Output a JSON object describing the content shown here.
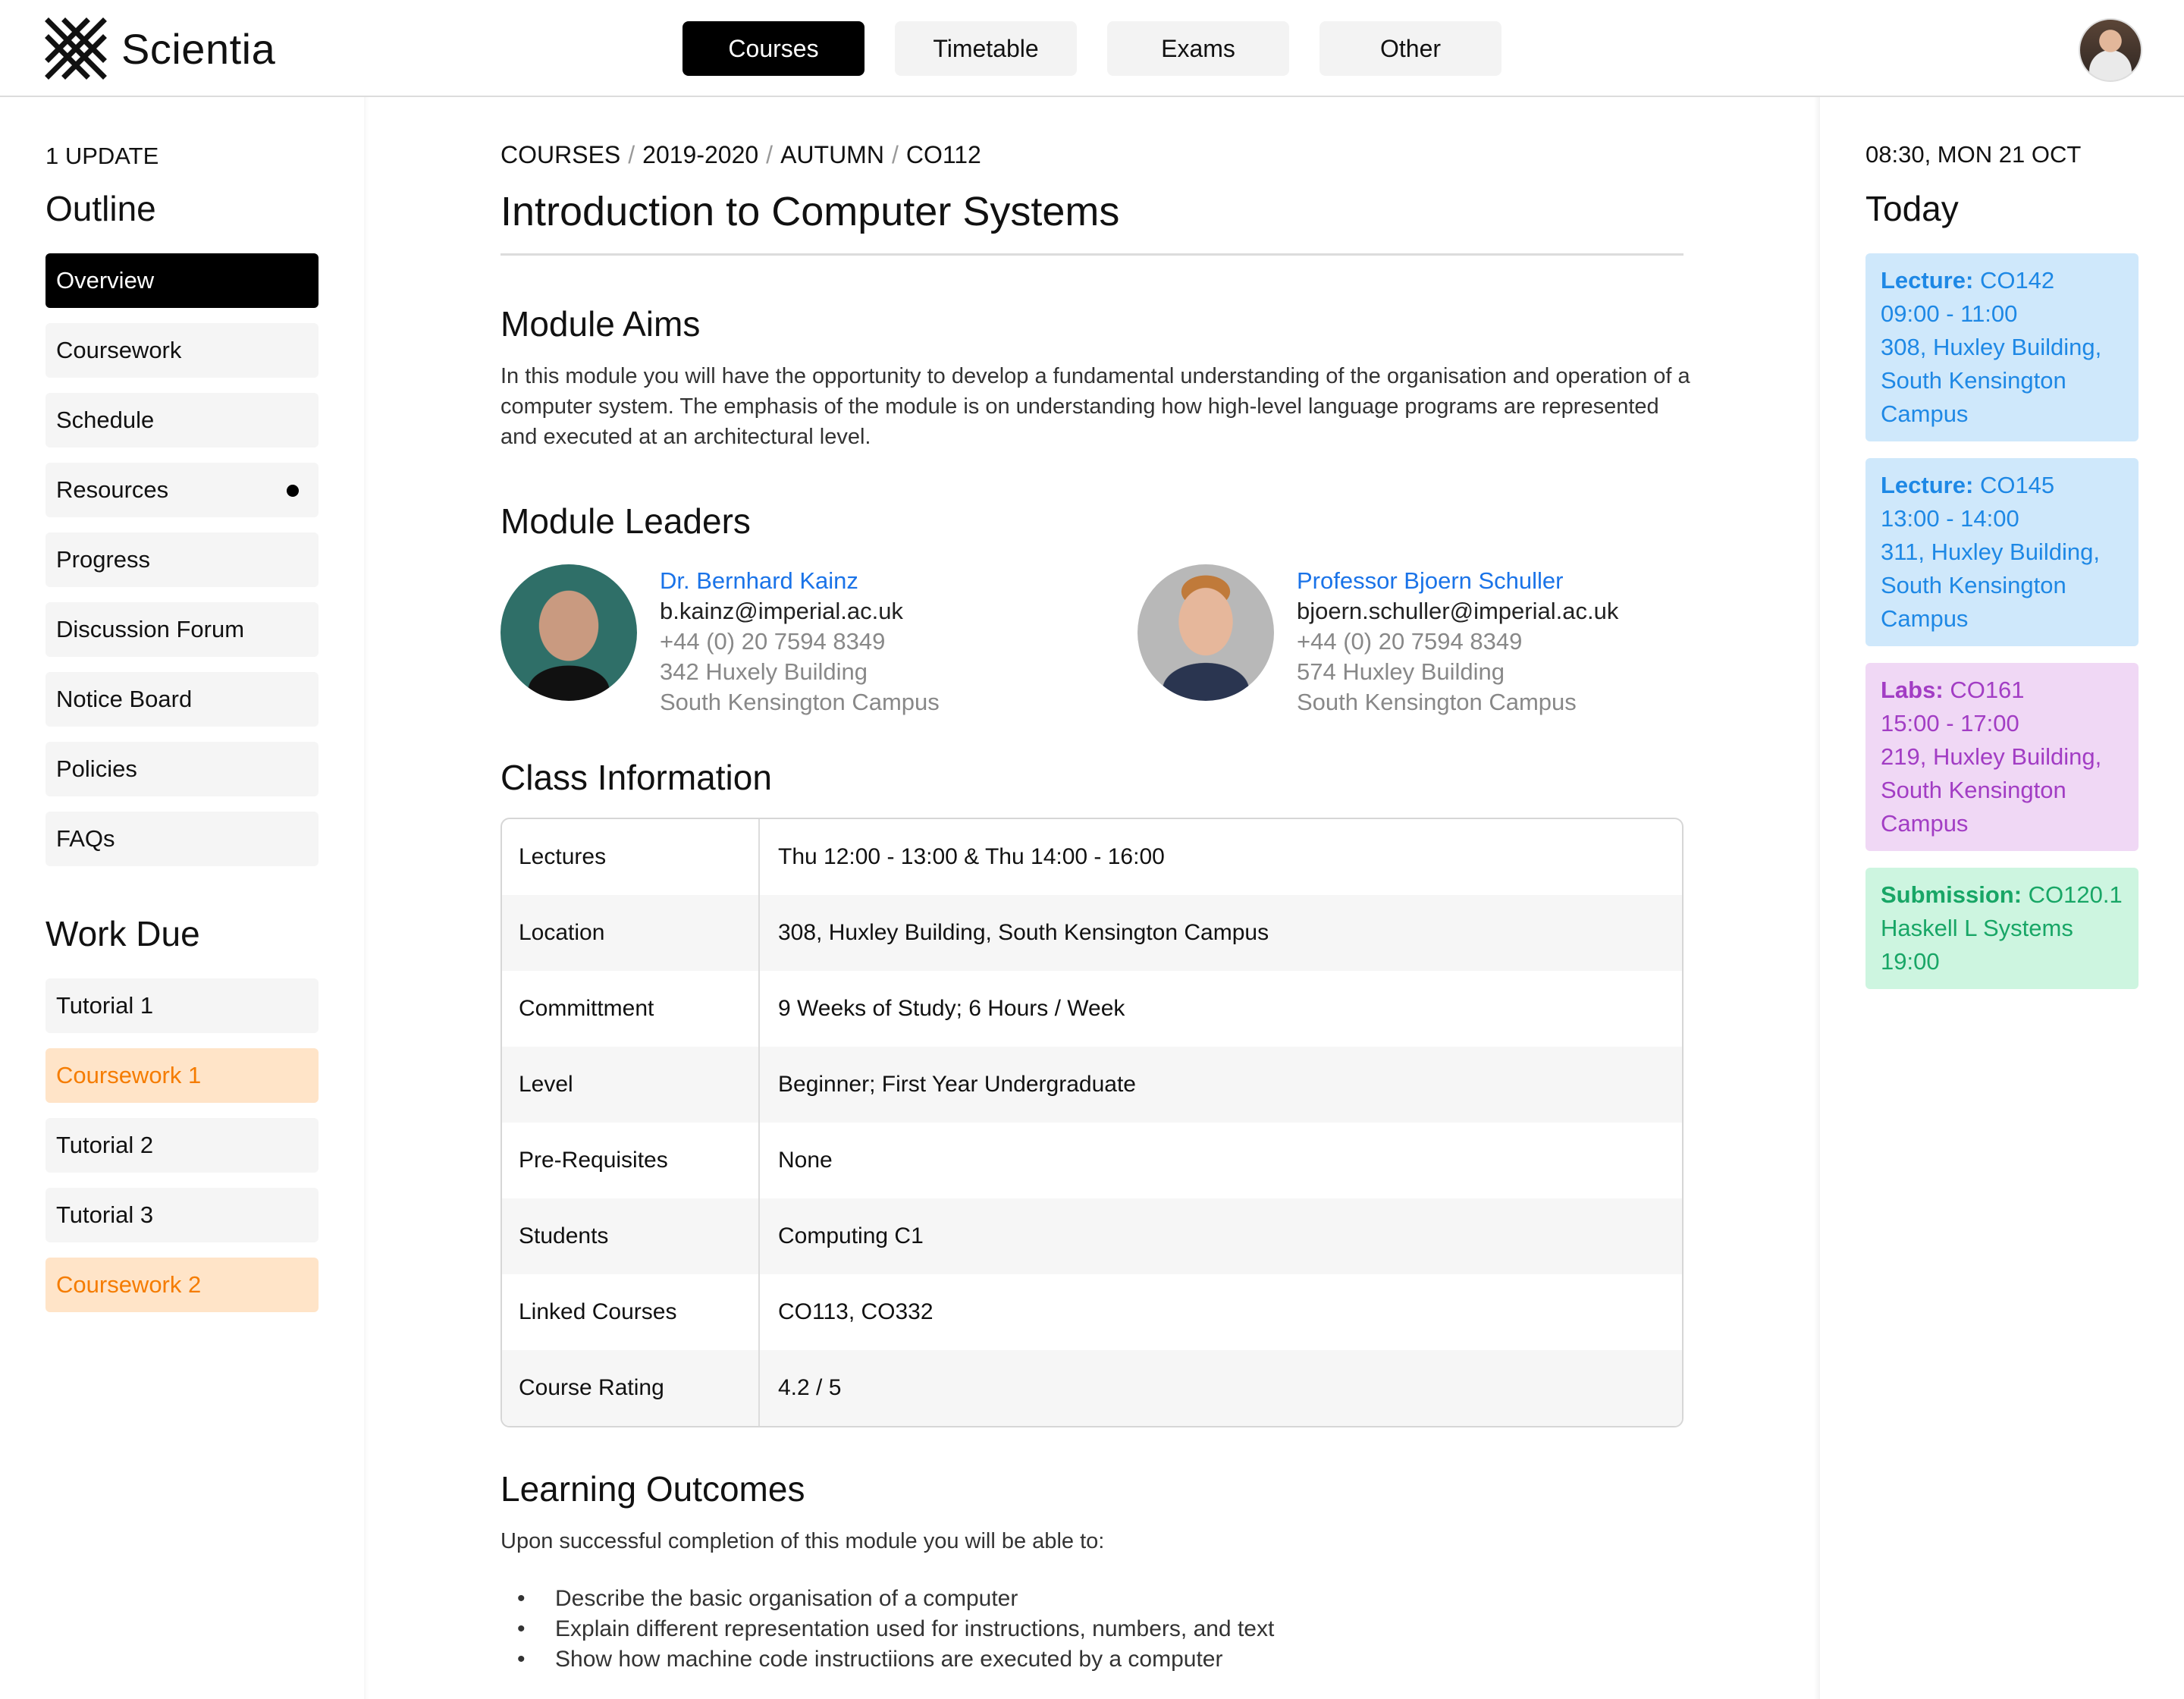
{
  "app": {
    "name": "Scientia"
  },
  "nav": {
    "tabs": [
      "Courses",
      "Timetable",
      "Exams",
      "Other"
    ],
    "active": "Courses"
  },
  "left": {
    "updates": "1 UPDATE",
    "outline_title": "Outline",
    "outline": [
      {
        "label": "Overview",
        "active": true
      },
      {
        "label": "Coursework"
      },
      {
        "label": "Schedule"
      },
      {
        "label": "Resources",
        "has_dot": true
      },
      {
        "label": "Progress"
      },
      {
        "label": "Discussion Forum"
      },
      {
        "label": "Notice Board"
      },
      {
        "label": "Policies"
      },
      {
        "label": "FAQs"
      }
    ],
    "workdue_title": "Work Due",
    "workdue": [
      {
        "label": "Tutorial 1"
      },
      {
        "label": "Coursework 1",
        "highlight": "#f57c00"
      },
      {
        "label": "Tutorial 2"
      },
      {
        "label": "Tutorial 3"
      },
      {
        "label": "Coursework 2",
        "highlight": "#f57c00"
      }
    ]
  },
  "breadcrumb": [
    "COURSES",
    "2019-2020",
    "AUTUMN",
    "CO112"
  ],
  "breadcrumb_sep": "/",
  "title": "Introduction to Computer Systems",
  "aims": {
    "heading": "Module Aims",
    "text": "In this module you will have the opportunity to develop a fundamental understanding of the organisation and operation of a computer system. The emphasis of the module is on understanding how high-level language programs are represented and executed at an architectural level."
  },
  "leaders": {
    "heading": "Module Leaders",
    "people": [
      {
        "name": "Dr. Bernhard Kainz",
        "email": "b.kainz@imperial.ac.uk",
        "phone": "+44 (0) 20 7594 8349",
        "office": "342 Huxely Building",
        "campus": "South Kensington Campus"
      },
      {
        "name": "Professor Bjoern Schuller",
        "email": "bjoern.schuller@imperial.ac.uk",
        "phone": "+44 (0) 20 7594 8349",
        "office": "574 Huxley Building",
        "campus": "South Kensington Campus"
      }
    ]
  },
  "class_info": {
    "heading": "Class Information",
    "rows": [
      {
        "key": "Lectures",
        "value": "Thu 12:00 - 13:00 & Thu 14:00 - 16:00"
      },
      {
        "key": "Location",
        "value": "308, Huxley Building, South Kensington Campus"
      },
      {
        "key": "Committment",
        "value": "9 Weeks of Study; 6 Hours / Week"
      },
      {
        "key": "Level",
        "value": "Beginner; First Year Undergraduate"
      },
      {
        "key": "Pre-Requisites",
        "value": "None"
      },
      {
        "key": "Students",
        "value": "Computing C1"
      },
      {
        "key": "Linked Courses",
        "value": "CO113, CO332"
      },
      {
        "key": "Course Rating",
        "value": "4.2 / 5"
      }
    ]
  },
  "outcomes": {
    "heading": "Learning Outcomes",
    "intro": "Upon successful completion of this module you will be able to:",
    "bullet": "•",
    "items": [
      "Describe the basic organisation of a computer",
      "Explain different representation used for instructions, numbers, and text",
      "Show how machine code instructiions are executed by a computer"
    ]
  },
  "right": {
    "datetime": "08:30, MON 21 OCT",
    "today_title": "Today",
    "events": [
      {
        "type": "Lecture:",
        "code": "CO142",
        "time": "09:00 - 11:00",
        "place": "308, Huxley Building, South Kensington Campus",
        "color": "blue"
      },
      {
        "type": "Lecture:",
        "code": "CO145",
        "time": "13:00 - 14:00",
        "place": "311, Huxley Building, South Kensington Campus",
        "color": "blue"
      },
      {
        "type": "Labs:",
        "code": "CO161",
        "time": "15:00 - 17:00",
        "place": "219, Huxley Building, South Kensington Campus",
        "color": "purple"
      },
      {
        "type": "Submission:",
        "code": "CO120.1",
        "time": "Haskell L Systems",
        "place": "19:00",
        "color": "green"
      }
    ]
  }
}
